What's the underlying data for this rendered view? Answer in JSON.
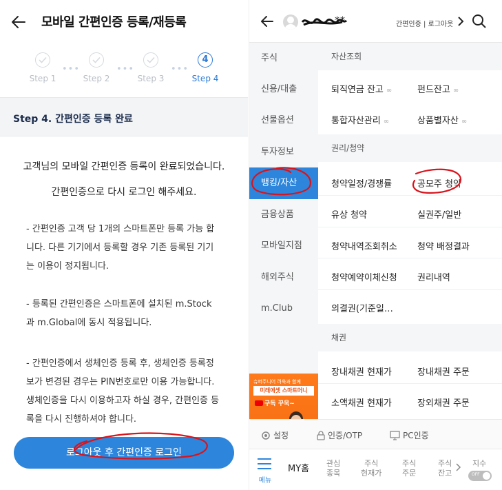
{
  "left": {
    "title": "모바일 간편인증 등록/재등록",
    "steps": [
      {
        "label": "Step 1"
      },
      {
        "label": "Step 2"
      },
      {
        "label": "Step 3"
      },
      {
        "label": "Step 4",
        "number": "4"
      }
    ],
    "section_title": "Step 4. 간편인증 등록 완료",
    "message_1": "고객님의 모바일 간편인증 등록이 완료되었습니다.",
    "message_2": "간편인증으로 다시 로그인 해주세요.",
    "note_1": [
      "- 간편인증 고객 당 1개의 스마트폰만 등록 가능 합",
      "니다. 다른 기기에서 등록할 경우 기존 등록된 기기",
      "는 이용이 정지됩니다."
    ],
    "note_2": [
      "- 등록된 간편인증은 스마트폰에 설치된 m.Stock",
      "과 m.Global에 동시 적용됩니다."
    ],
    "note_3": [
      "- 간편인증에서 생체인증 등록 후, 생체인증 등록정",
      "보가  변경된 경우는 PIN번호로만 이용 가능합니다.",
      "생체인증을 다시 이용하고자 하실 경우, 간편인증 등",
      "록을 다시 진행하셔야 합니다."
    ],
    "button_label": "로그아웃 후 간편인증 로그인"
  },
  "right": {
    "user_name": "**",
    "header_links": "간편인증 | 로그아웃",
    "menu": [
      "주식",
      "신용/대출",
      "선물옵션",
      "투자정보",
      "뱅킹/자산",
      "금융상품",
      "모바일지점",
      "해외주식",
      "m.Club"
    ],
    "active_menu_index": 4,
    "banner": {
      "line1": "슈퍼주니어 려욱과 함께",
      "line2": "미래에셋 스마트머니",
      "line3": "구독 꾸욱~"
    },
    "sections": {
      "asset_title": "자산조회",
      "asset_items": [
        "퇴직연금 잔고",
        "펀드잔고",
        "통합자산관리",
        "상품별자산"
      ],
      "rights_title": "권리/청약",
      "rights_items": [
        "청약일정/경쟁률",
        "공모주 청약",
        "유상 청약",
        "실권주/일반",
        "청약내역조회취소",
        "청약 배정결과",
        "청약예약이체신청",
        "권리내역",
        "의결권(기준일…"
      ],
      "bond_title": "채권",
      "bond_items": [
        "장내채권 현재가",
        "장내채권 주문",
        "소액채권 현재가",
        "장외채권 주문"
      ]
    },
    "link_icon": "∞",
    "bottom_links": [
      "설정",
      "인증/OTP",
      "PC인증"
    ],
    "tabbar": {
      "menu_label": "메뉴",
      "home_label": "MY홈",
      "tabs": [
        [
          "관심",
          "종목"
        ],
        [
          "주식",
          "현재가"
        ],
        [
          "주식",
          "주문"
        ],
        [
          "주식",
          "잔고"
        ]
      ],
      "index_label": "지수",
      "toggle_label": "OFF"
    }
  },
  "colors": {
    "accent": "#2d86dc",
    "annotation": "#d8141c",
    "banner": "#f36a10"
  }
}
